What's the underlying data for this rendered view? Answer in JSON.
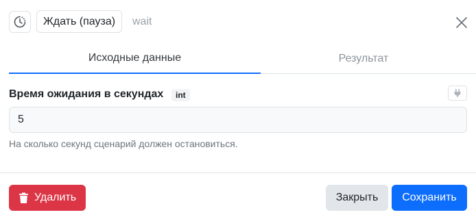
{
  "header": {
    "action_label": "Ждать (пауза)",
    "action_id": "wait",
    "icon": "clock-pause-icon",
    "close_icon": "close-icon"
  },
  "tabs": [
    {
      "label": "Исходные данные",
      "active": true
    },
    {
      "label": "Результат",
      "active": false
    }
  ],
  "field": {
    "label": "Время ожидания в секундах",
    "type_badge": "int",
    "value": "5",
    "help": "На сколько секунд сценарий должен остановиться.",
    "plug_icon": "plug-icon"
  },
  "footer": {
    "delete_label": "Удалить",
    "delete_icon": "trash-icon",
    "close_label": "Закрыть",
    "save_label": "Сохранить"
  },
  "colors": {
    "primary": "#0d6efd",
    "danger": "#dc3545",
    "secondary_bg": "#e2e6ea",
    "border": "#dee2e6"
  }
}
